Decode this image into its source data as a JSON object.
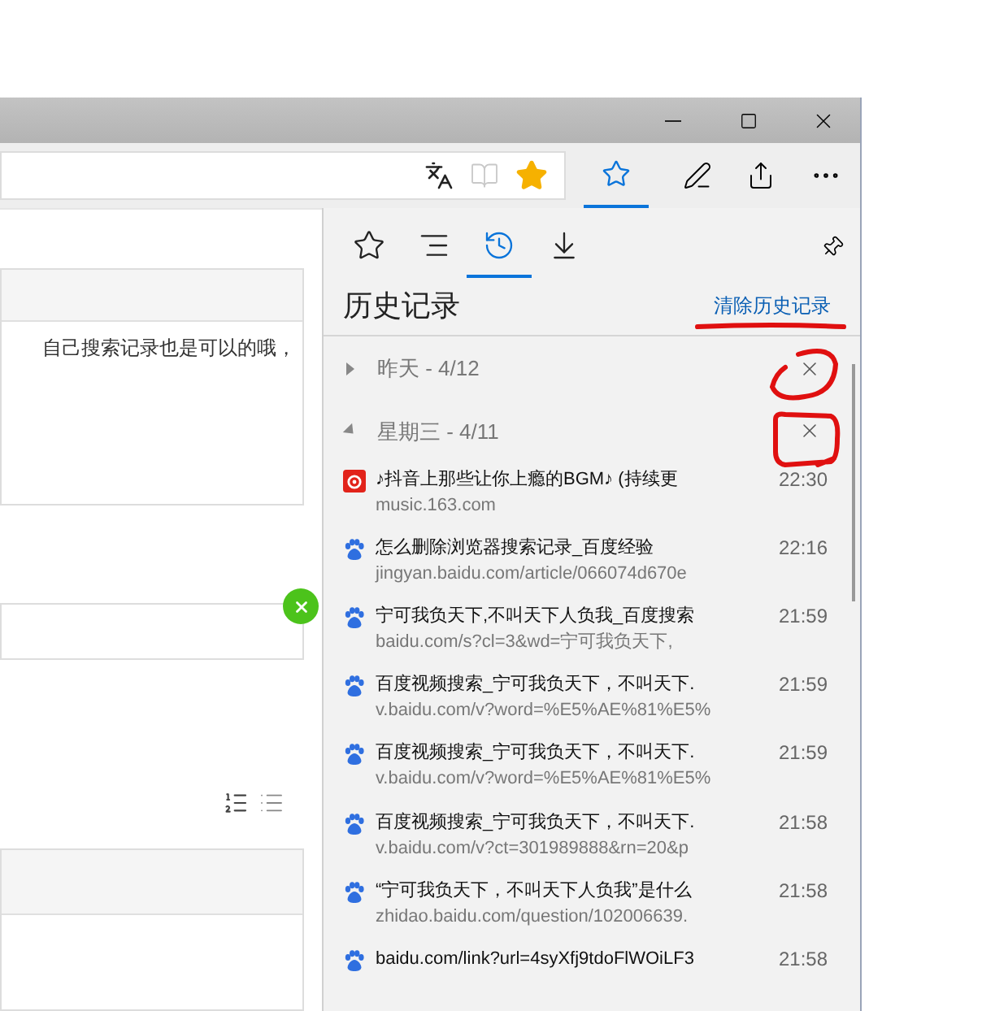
{
  "toolbar": {
    "favorites_selected": true
  },
  "page": {
    "panel_text": "自己搜索记录也是可以的哦，"
  },
  "hub": {
    "tabs": [
      {
        "kind": "favorites",
        "selected": false
      },
      {
        "kind": "reading",
        "selected": false
      },
      {
        "kind": "history",
        "selected": true
      },
      {
        "kind": "downloads",
        "selected": false
      }
    ],
    "title": "历史记录",
    "clear_link": "清除历史记录",
    "groups": [
      {
        "label": "昨天 - 4/12",
        "expanded": false
      },
      {
        "label": "星期三 - 4/11",
        "expanded": true
      }
    ],
    "items": [
      {
        "kind": "netease",
        "title": "♪抖音上那些让你上瘾的BGM♪ (持续更",
        "url": "music.163.com",
        "time": "22:30"
      },
      {
        "kind": "baidu",
        "title": "怎么删除浏览器搜索记录_百度经验",
        "url": "jingyan.baidu.com/article/066074d670e",
        "time": "22:16"
      },
      {
        "kind": "baidu",
        "title": "宁可我负天下,不叫天下人负我_百度搜索",
        "url": "baidu.com/s?cl=3&wd=宁可我负天下,",
        "time": "21:59"
      },
      {
        "kind": "baidu",
        "title": "百度视频搜索_宁可我负天下，不叫天下.",
        "url": "v.baidu.com/v?word=%E5%AE%81%E5%",
        "time": "21:59"
      },
      {
        "kind": "baidu",
        "title": "百度视频搜索_宁可我负天下，不叫天下.",
        "url": "v.baidu.com/v?word=%E5%AE%81%E5%",
        "time": "21:59"
      },
      {
        "kind": "baidu",
        "title": "百度视频搜索_宁可我负天下，不叫天下.",
        "url": "v.baidu.com/v?ct=301989888&rn=20&p",
        "time": "21:58"
      },
      {
        "kind": "baidu",
        "title": "“宁可我负天下，不叫天下人负我”是什么",
        "url": "zhidao.baidu.com/question/102006639.",
        "time": "21:58"
      },
      {
        "kind": "baidu",
        "title": "baidu.com/link?url=4syXfj9tdoFlWOiLF3",
        "time": "21:58"
      }
    ]
  }
}
